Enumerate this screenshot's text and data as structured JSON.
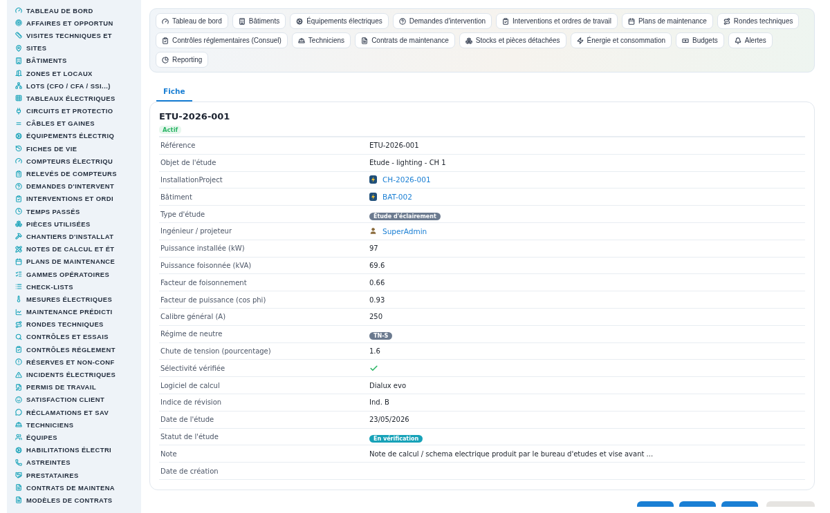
{
  "sidebar": {
    "items": [
      {
        "label": "TABLEAU DE BORD"
      },
      {
        "label": "AFFAIRES ET OPPORTUN"
      },
      {
        "label": "VISITES TECHNIQUES ET"
      },
      {
        "label": "SITES"
      },
      {
        "label": "BÂTIMENTS"
      },
      {
        "label": "ZONES ET LOCAUX"
      },
      {
        "label": "LOTS (CFO / CFA / SSI...)"
      },
      {
        "label": "TABLEAUX ÉLECTRIQUES"
      },
      {
        "label": "CIRCUITS ET PROTECTIO"
      },
      {
        "label": "CÂBLES ET GAINES"
      },
      {
        "label": "ÉQUIPEMENTS ÉLECTRIQ"
      },
      {
        "label": "FICHES DE VIE"
      },
      {
        "label": "COMPTEURS ÉLECTRIQU"
      },
      {
        "label": "RELEVÉS DE COMPTEURS"
      },
      {
        "label": "DEMANDES D'INTERVENT"
      },
      {
        "label": "INTERVENTIONS ET ORDI"
      },
      {
        "label": "TEMPS PASSÉS"
      },
      {
        "label": "PIÈCES UTILISÉES"
      },
      {
        "label": "CHANTIERS D'INSTALLAT"
      },
      {
        "label": "NOTES DE CALCUL ET ÉT"
      },
      {
        "label": "PLANS DE MAINTENANCE"
      },
      {
        "label": "GAMMES OPÉRATOIRES"
      },
      {
        "label": "CHECK-LISTS"
      },
      {
        "label": "MESURES ÉLECTRIQUES"
      },
      {
        "label": "MAINTENANCE PRÉDICTI"
      },
      {
        "label": "RONDES TECHNIQUES"
      },
      {
        "label": "CONTRÔLES ET ESSAIS"
      },
      {
        "label": "CONTRÔLES RÉGLEMENT"
      },
      {
        "label": "RÉSERVES ET NON-CONF"
      },
      {
        "label": "INCIDENTS ÉLECTRIQUES"
      },
      {
        "label": "PERMIS DE TRAVAIL"
      },
      {
        "label": "SATISFACTION CLIENT"
      },
      {
        "label": "RÉCLAMATIONS ET SAV"
      },
      {
        "label": "TECHNICIENS"
      },
      {
        "label": "ÉQUIPES"
      },
      {
        "label": "HABILITATIONS ÉLECTRI"
      },
      {
        "label": "ASTREINTES"
      },
      {
        "label": "PRESTATAIRES"
      },
      {
        "label": "CONTRATS DE MAINTENA"
      },
      {
        "label": "MODÈLES DE CONTRATS"
      }
    ]
  },
  "quick_links": [
    {
      "label": "Tableau de bord"
    },
    {
      "label": "Bâtiments"
    },
    {
      "label": "Équipements électriques"
    },
    {
      "label": "Demandes d'intervention"
    },
    {
      "label": "Interventions et ordres de travail"
    },
    {
      "label": "Plans de maintenance"
    },
    {
      "label": "Rondes techniques"
    },
    {
      "label": "Contrôles réglementaires (Consuel)"
    },
    {
      "label": "Techniciens"
    },
    {
      "label": "Contrats de maintenance"
    },
    {
      "label": "Stocks et pièces détachées"
    },
    {
      "label": "Énergie et consommation"
    },
    {
      "label": "Budgets"
    },
    {
      "label": "Alertes"
    },
    {
      "label": "Reporting"
    }
  ],
  "tabs": [
    {
      "label": "Fiche",
      "selected": true
    }
  ],
  "record": {
    "title": "ETU-2026-001",
    "status": "Actif",
    "fields": [
      {
        "label": "Référence",
        "kind": "text",
        "value": "ETU-2026-001"
      },
      {
        "label": "Objet de l'étude",
        "kind": "text",
        "value": "Etude - lighting - CH 1"
      },
      {
        "label": "InstallationProject",
        "kind": "link",
        "value": "CH-2026-001"
      },
      {
        "label": "Bâtiment",
        "kind": "link",
        "value": "BAT-002"
      },
      {
        "label": "Type d'étude",
        "kind": "badge",
        "color": "#6b7a8f",
        "value": "Étude d'éclairement"
      },
      {
        "label": "Ingénieur / projeteur",
        "kind": "user",
        "value": "SuperAdmin"
      },
      {
        "label": "Puissance installée (kW)",
        "kind": "text",
        "value": "97"
      },
      {
        "label": "Puissance foisonnée (kVA)",
        "kind": "text",
        "value": "69.6"
      },
      {
        "label": "Facteur de foisonnement",
        "kind": "text",
        "value": "0.66"
      },
      {
        "label": "Facteur de puissance (cos phi)",
        "kind": "text",
        "value": "0.93"
      },
      {
        "label": "Calibre général (A)",
        "kind": "text",
        "value": "250"
      },
      {
        "label": "Régime de neutre",
        "kind": "badge",
        "color": "#6b7a8f",
        "value": "TN-S"
      },
      {
        "label": "Chute de tension (pourcentage)",
        "kind": "text",
        "value": "1.6"
      },
      {
        "label": "Sélectivité vérifiée",
        "kind": "check",
        "checked": true
      },
      {
        "label": "Logiciel de calcul",
        "kind": "text",
        "value": "Dialux evo"
      },
      {
        "label": "Indice de révision",
        "kind": "text",
        "value": "Ind. B"
      },
      {
        "label": "Date de l'étude",
        "kind": "text",
        "value": "23/05/2026"
      },
      {
        "label": "Statut de l'étude",
        "kind": "badge",
        "color": "#17a2b8",
        "value": "En vérification"
      },
      {
        "label": "Note",
        "kind": "text",
        "value": "Note de calcul / schema electrique produit par le bureau d'etudes et vise avant ..."
      },
      {
        "label": "Date de création",
        "kind": "text"
      }
    ]
  },
  "actions": [
    {
      "kind": "primary"
    },
    {
      "kind": "primary"
    },
    {
      "kind": "primary"
    },
    {
      "kind": "secondary"
    }
  ]
}
